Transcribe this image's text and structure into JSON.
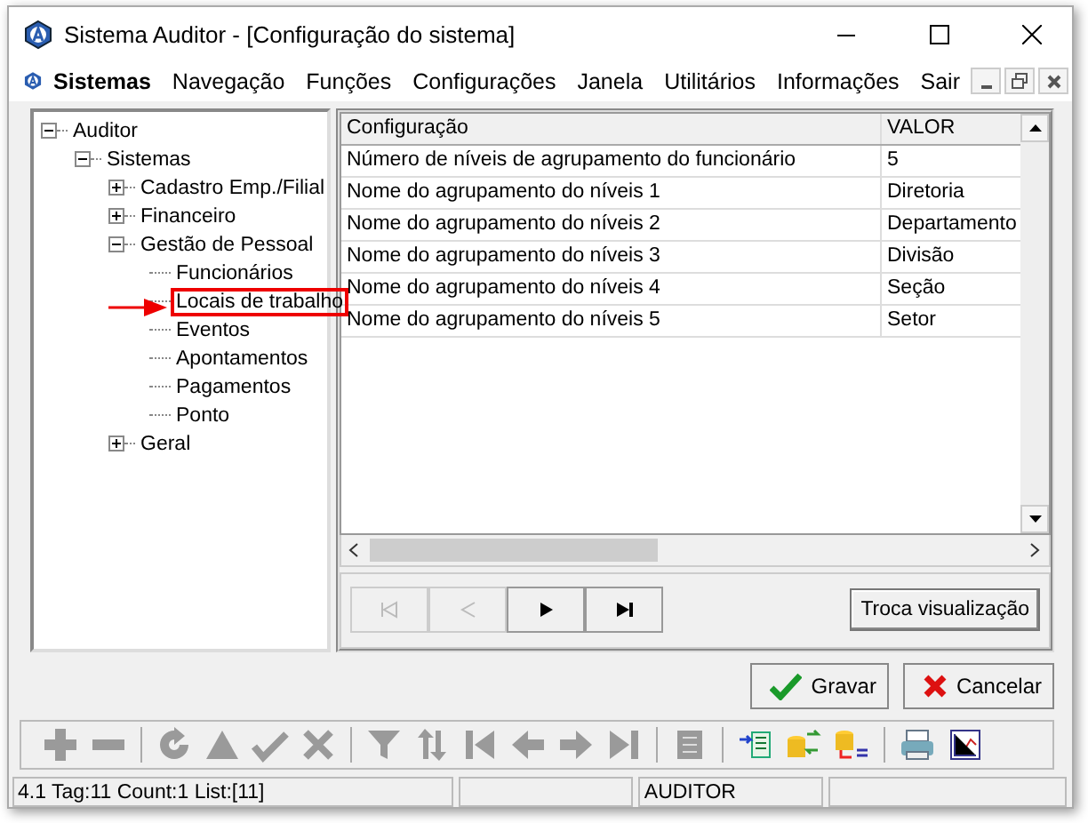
{
  "window": {
    "title": "Sistema Auditor - [Configuração do sistema]"
  },
  "menu": [
    {
      "label": "Sistemas",
      "bold": true
    },
    {
      "label": "Navegação",
      "bold": false
    },
    {
      "label": "Funções",
      "bold": false
    },
    {
      "label": "Configurações",
      "bold": false
    },
    {
      "label": "Janela",
      "bold": false
    },
    {
      "label": "Utilitários",
      "bold": false
    },
    {
      "label": "Informações",
      "bold": false
    },
    {
      "label": "Sair",
      "bold": false
    }
  ],
  "tree": [
    {
      "label": "Auditor",
      "expanded": true,
      "marked": false,
      "children": [
        {
          "label": "Sistemas",
          "expanded": true,
          "marked": false,
          "children": [
            {
              "label": "Cadastro Emp./Filial",
              "expanded": false,
              "marked": false
            },
            {
              "label": "Financeiro",
              "expanded": false,
              "marked": false
            },
            {
              "label": "Gestão de Pessoal",
              "expanded": true,
              "marked": false,
              "children": [
                {
                  "label": "Funcionários",
                  "marked": false
                },
                {
                  "label": "Locais de trabalho",
                  "marked": true
                },
                {
                  "label": "Eventos",
                  "marked": false
                },
                {
                  "label": "Apontamentos",
                  "marked": false
                },
                {
                  "label": "Pagamentos",
                  "marked": false
                },
                {
                  "label": "Ponto",
                  "marked": false
                }
              ]
            },
            {
              "label": "Geral",
              "expanded": false,
              "marked": false
            }
          ]
        }
      ]
    }
  ],
  "table": {
    "columns": [
      "Configuração",
      "VALOR"
    ],
    "rows": [
      [
        "Número de níveis de agrupamento do funcionário",
        "5"
      ],
      [
        "Nome do agrupamento do níveis 1",
        "Diretoria"
      ],
      [
        "Nome do agrupamento do níveis 2",
        "Departamento"
      ],
      [
        "Nome do agrupamento do níveis 3",
        "Divisão"
      ],
      [
        "Nome do agrupamento do níveis 4",
        "Seção"
      ],
      [
        "Nome do agrupamento do níveis 5",
        "Setor"
      ]
    ]
  },
  "navigator": [
    {
      "kind": "first",
      "disabled": true
    },
    {
      "kind": "prev",
      "disabled": true
    },
    {
      "kind": "next",
      "disabled": false
    },
    {
      "kind": "last",
      "disabled": false
    }
  ],
  "view_button": "Troca visualização",
  "actions": [
    {
      "kind": "save",
      "label": "Gravar"
    },
    {
      "kind": "cancel",
      "label": "Cancelar"
    }
  ],
  "toolbar": [
    {
      "kind": "add",
      "disabled": true
    },
    {
      "kind": "remove",
      "disabled": true
    },
    {
      "kind": "sep"
    },
    {
      "kind": "refresh",
      "disabled": true
    },
    {
      "kind": "up",
      "disabled": true
    },
    {
      "kind": "check",
      "disabled": true
    },
    {
      "kind": "cross",
      "disabled": true
    },
    {
      "kind": "sep"
    },
    {
      "kind": "filter",
      "disabled": true
    },
    {
      "kind": "sort",
      "disabled": true
    },
    {
      "kind": "first",
      "disabled": true
    },
    {
      "kind": "left",
      "disabled": true
    },
    {
      "kind": "right",
      "disabled": true
    },
    {
      "kind": "last",
      "disabled": true
    },
    {
      "kind": "sep"
    },
    {
      "kind": "doc",
      "disabled": true
    },
    {
      "kind": "sep"
    },
    {
      "kind": "import",
      "disabled": false
    },
    {
      "kind": "dbexchange",
      "disabled": false
    },
    {
      "kind": "dblist",
      "disabled": false
    },
    {
      "kind": "sep"
    },
    {
      "kind": "print",
      "disabled": false
    },
    {
      "kind": "report",
      "disabled": false
    }
  ],
  "status_bar": {
    "panel_1": "4.1 Tag:11 Count:1 List:[11]",
    "panel_3": "AUDITOR"
  }
}
